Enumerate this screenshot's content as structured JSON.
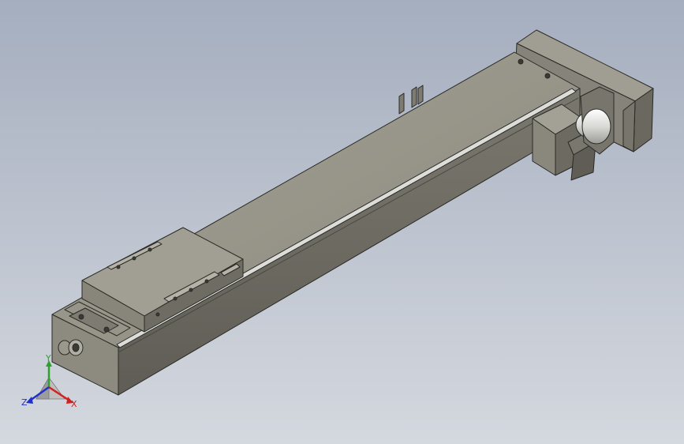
{
  "viewport": {
    "background_top": "#a5aebf",
    "background_bottom": "#d4d8df"
  },
  "model": {
    "body_color": "#8f8d82",
    "body_top_color": "#9c9a8e",
    "body_side_color": "#6d6b62",
    "edge_color": "#2a2a26",
    "rail_color": "#d8d8d4",
    "motor_cylinder_color": "#e6e6e2"
  },
  "triad": {
    "x_label": "X",
    "y_label": "Y",
    "z_label": "Z",
    "x_color": "#d22020",
    "y_color": "#2ea02e",
    "z_color": "#2030c8"
  }
}
